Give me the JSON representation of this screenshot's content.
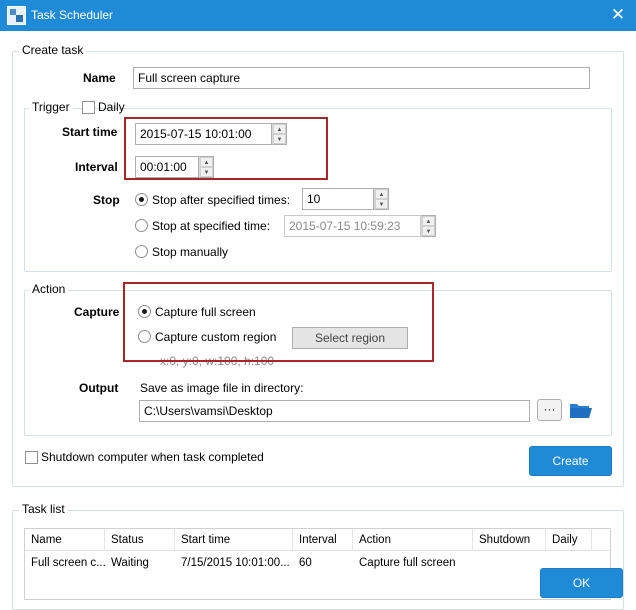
{
  "window": {
    "title": "Task Scheduler",
    "close_glyph": "✕"
  },
  "create_task": {
    "group_label": "Create task",
    "name_label": "Name",
    "name_value": "Full screen capture"
  },
  "trigger": {
    "group_label": "Trigger",
    "daily_label": "Daily",
    "daily_checked": false,
    "start_time_label": "Start time",
    "start_time_value": "2015-07-15 10:01:00",
    "interval_label": "Interval",
    "interval_value": "00:01:00",
    "stop_label": "Stop",
    "stop_options": [
      {
        "label": "Stop after specified times:",
        "checked": true
      },
      {
        "label": "Stop at specified time:",
        "checked": false
      },
      {
        "label": "Stop manually",
        "checked": false
      }
    ],
    "stop_times_value": "10",
    "stop_at_value": "2015-07-15 10:59:23"
  },
  "action": {
    "group_label": "Action",
    "capture_label": "Capture",
    "capture_options": [
      {
        "label": "Capture full screen",
        "checked": true
      },
      {
        "label": "Capture custom region",
        "checked": false
      }
    ],
    "select_region_label": "Select region",
    "region_text": "x:0, y:0, w:100, h:100",
    "output_label": "Output",
    "output_hint": "Save as image file in directory:",
    "output_path": "C:\\Users\\vamsi\\Desktop",
    "browse_label": "···"
  },
  "shutdown": {
    "label": "Shutdown computer when task completed",
    "checked": false
  },
  "create_button_label": "Create",
  "task_list": {
    "group_label": "Task list",
    "columns": [
      "Name",
      "Status",
      "Start time",
      "Interval",
      "Action",
      "Shutdown",
      "Daily"
    ],
    "rows": [
      [
        "Full screen c...",
        "Waiting",
        "7/15/2015 10:01:00...",
        "60",
        "Capture full screen",
        "",
        ""
      ]
    ]
  },
  "ok_button_label": "OK",
  "colors": {
    "accent": "#1f8ad6",
    "highlight": "#a6262a",
    "frame": "#d5dfe5"
  }
}
